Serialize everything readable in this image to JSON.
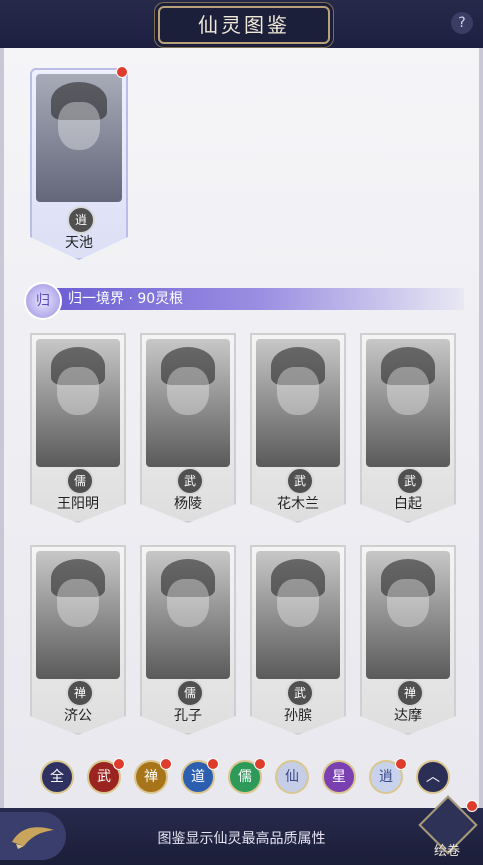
{
  "header": {
    "title": "仙灵图鉴"
  },
  "featured": {
    "name": "天池",
    "badge": "逍",
    "has_alert": true
  },
  "realm": {
    "label": "归一境界 · 90灵根",
    "emblem": "归"
  },
  "cards": [
    {
      "name": "王阳明",
      "badge": "儒"
    },
    {
      "name": "杨陵",
      "badge": "武"
    },
    {
      "name": "花木兰",
      "badge": "武"
    },
    {
      "name": "白起",
      "badge": "武"
    },
    {
      "name": "济公",
      "badge": "禅"
    },
    {
      "name": "孔子",
      "badge": "儒"
    },
    {
      "name": "孙膑",
      "badge": "武"
    },
    {
      "name": "达摩",
      "badge": "禅"
    }
  ],
  "categories": [
    {
      "label": "全",
      "color": "#2f3160",
      "alert": false
    },
    {
      "label": "武",
      "color": "#9a2420",
      "alert": true
    },
    {
      "label": "禅",
      "color": "#a8741a",
      "alert": true
    },
    {
      "label": "道",
      "color": "#2d5fb0",
      "alert": true
    },
    {
      "label": "儒",
      "color": "#2e9a5a",
      "alert": true
    },
    {
      "label": "仙",
      "color": "#c6cde6",
      "alert": false
    },
    {
      "label": "星",
      "color": "#7a3fb0",
      "alert": false
    },
    {
      "label": "逍",
      "color": "#c9d2ec",
      "alert": true
    },
    {
      "label": "︿",
      "color": "#2b2e55",
      "alert": false
    }
  ],
  "footer": {
    "note": "图鉴显示仙灵最高品质属性",
    "scroll_label": "绘卷"
  }
}
